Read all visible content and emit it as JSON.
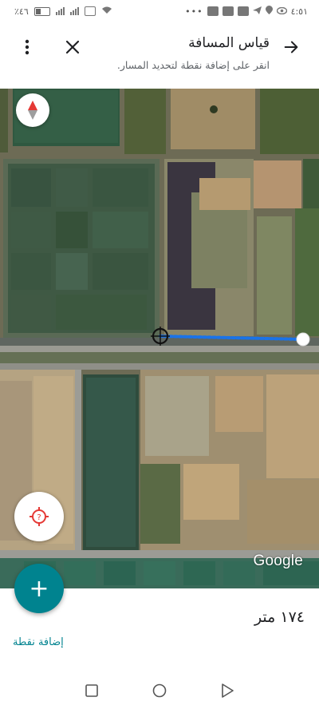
{
  "status_bar": {
    "time": "٤:٥١",
    "battery": "٪٤٦"
  },
  "header": {
    "title": "قياس المسافة",
    "subtitle": "انقر على إضافة نقطة لتحديد المسار.",
    "back_icon": "arrow-back-icon",
    "close_icon": "close-icon",
    "menu_icon": "more-vert-icon"
  },
  "map": {
    "watermark": "Google",
    "compass_icon": "compass-icon",
    "locate_icon": "my-location-icon"
  },
  "fab": {
    "label": "+",
    "icon": "plus-icon"
  },
  "measurement": {
    "distance": "١٧٤ متر",
    "add_point_label": "إضافة نقطة"
  },
  "nav_bar": {
    "recents_icon": "square-icon",
    "home_icon": "circle-icon",
    "back_icon": "triangle-icon"
  },
  "colors": {
    "accent": "#00838f",
    "route": "#1a73e8"
  }
}
